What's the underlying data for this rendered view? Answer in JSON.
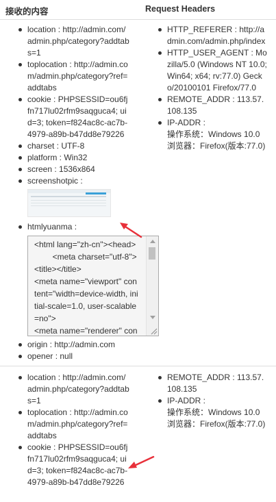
{
  "header": {
    "col1": "接收的内容",
    "col2": "Request Headers"
  },
  "rows": [
    {
      "left": {
        "location": "location : http://admin.com/admin.php/category?addtabs=1",
        "toplocation": "toplocation : http://admin.com/admin.php/category?ref=addtabs",
        "cookie": "cookie : PHPSESSID=ou6fjfn717lu02rfm9saqguca4; uid=3; token=f824ac8c-ac7b-4979-a89b-b47dd8e79226",
        "charset": "charset : UTF-8",
        "platform": "platform : Win32",
        "screen": "screen : 1536x864",
        "screenshotpic": "screenshotpic :",
        "htmlyuanma": "htmlyuanma :",
        "htmlyuanma_code": "<html lang=\"zh-cn\"><head>\n        <meta charset=\"utf-8\">\n<title></title>\n<meta name=\"viewport\" content=\"width=device-width, initial-scale=1.0, user-scalable=no\">\n<meta name=\"renderer\" content=\"webkit\">",
        "origin": "origin : http://admin.com",
        "opener": "opener : null"
      },
      "right": {
        "http_referer": "HTTP_REFERER : http://admin.com/admin.php/index",
        "http_user_agent": "HTTP_USER_AGENT : Mozilla/5.0 (Windows NT 10.0; Win64; x64; rv:77.0) Gecko/20100101 Firefox/77.0",
        "remote_addr": "REMOTE_ADDR : 113.57.108.135",
        "ip_addr": "IP-ADDR :",
        "os": "操作系统：Windows 10.0",
        "browser": "浏览器：Firefox(版本:77.0)"
      }
    },
    {
      "left": {
        "location": "location : http://admin.com/admin.php/category?addtabs=1",
        "toplocation": "toplocation : http://admin.com/admin.php/category?ref=addtabs",
        "cookie": "cookie : PHPSESSID=ou6fjfn717lu02rfm9saqguca4; uid=3; token=f824ac8c-ac7b-4979-a89b-b47dd8e79226"
      },
      "right": {
        "remote_addr": "REMOTE_ADDR : 113.57.108.135",
        "ip_addr": "IP-ADDR :",
        "os": "操作系统：Windows 10.0",
        "browser": "浏览器：Firefox(版本:77.0)"
      }
    }
  ],
  "colors": {
    "text": "#333333",
    "border": "#dddddd",
    "annotation_arrow": "#e8303a"
  }
}
